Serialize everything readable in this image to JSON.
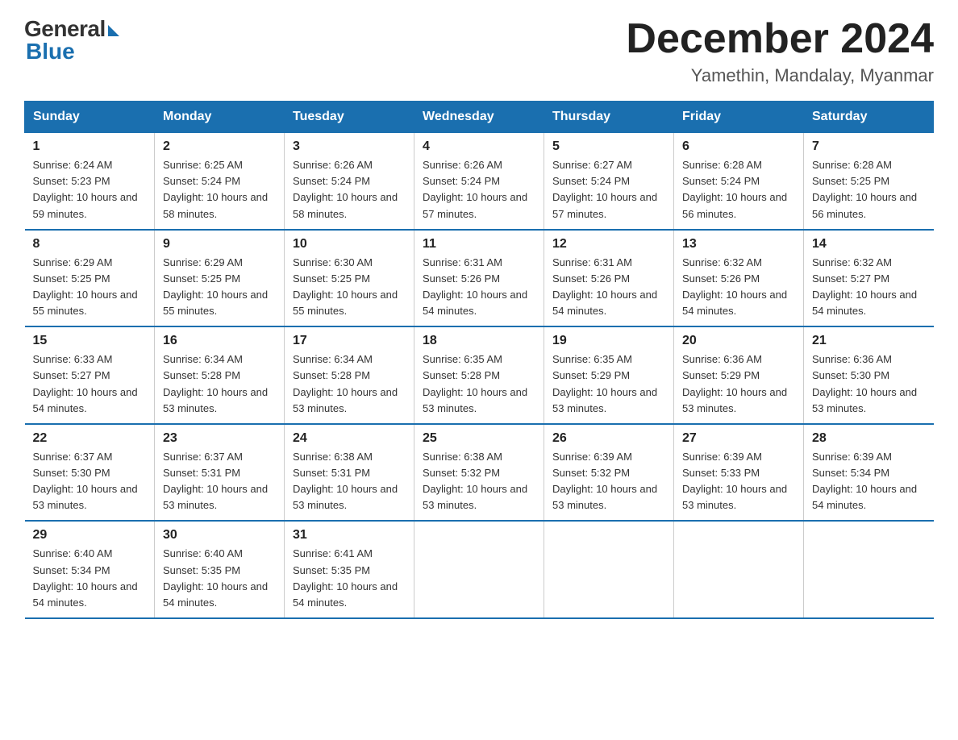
{
  "header": {
    "logo": {
      "general": "General",
      "blue": "Blue"
    },
    "title": "December 2024",
    "location": "Yamethin, Mandalay, Myanmar"
  },
  "calendar": {
    "columns": [
      "Sunday",
      "Monday",
      "Tuesday",
      "Wednesday",
      "Thursday",
      "Friday",
      "Saturday"
    ],
    "rows": [
      [
        {
          "date": "1",
          "sunrise": "Sunrise: 6:24 AM",
          "sunset": "Sunset: 5:23 PM",
          "daylight": "Daylight: 10 hours and 59 minutes."
        },
        {
          "date": "2",
          "sunrise": "Sunrise: 6:25 AM",
          "sunset": "Sunset: 5:24 PM",
          "daylight": "Daylight: 10 hours and 58 minutes."
        },
        {
          "date": "3",
          "sunrise": "Sunrise: 6:26 AM",
          "sunset": "Sunset: 5:24 PM",
          "daylight": "Daylight: 10 hours and 58 minutes."
        },
        {
          "date": "4",
          "sunrise": "Sunrise: 6:26 AM",
          "sunset": "Sunset: 5:24 PM",
          "daylight": "Daylight: 10 hours and 57 minutes."
        },
        {
          "date": "5",
          "sunrise": "Sunrise: 6:27 AM",
          "sunset": "Sunset: 5:24 PM",
          "daylight": "Daylight: 10 hours and 57 minutes."
        },
        {
          "date": "6",
          "sunrise": "Sunrise: 6:28 AM",
          "sunset": "Sunset: 5:24 PM",
          "daylight": "Daylight: 10 hours and 56 minutes."
        },
        {
          "date": "7",
          "sunrise": "Sunrise: 6:28 AM",
          "sunset": "Sunset: 5:25 PM",
          "daylight": "Daylight: 10 hours and 56 minutes."
        }
      ],
      [
        {
          "date": "8",
          "sunrise": "Sunrise: 6:29 AM",
          "sunset": "Sunset: 5:25 PM",
          "daylight": "Daylight: 10 hours and 55 minutes."
        },
        {
          "date": "9",
          "sunrise": "Sunrise: 6:29 AM",
          "sunset": "Sunset: 5:25 PM",
          "daylight": "Daylight: 10 hours and 55 minutes."
        },
        {
          "date": "10",
          "sunrise": "Sunrise: 6:30 AM",
          "sunset": "Sunset: 5:25 PM",
          "daylight": "Daylight: 10 hours and 55 minutes."
        },
        {
          "date": "11",
          "sunrise": "Sunrise: 6:31 AM",
          "sunset": "Sunset: 5:26 PM",
          "daylight": "Daylight: 10 hours and 54 minutes."
        },
        {
          "date": "12",
          "sunrise": "Sunrise: 6:31 AM",
          "sunset": "Sunset: 5:26 PM",
          "daylight": "Daylight: 10 hours and 54 minutes."
        },
        {
          "date": "13",
          "sunrise": "Sunrise: 6:32 AM",
          "sunset": "Sunset: 5:26 PM",
          "daylight": "Daylight: 10 hours and 54 minutes."
        },
        {
          "date": "14",
          "sunrise": "Sunrise: 6:32 AM",
          "sunset": "Sunset: 5:27 PM",
          "daylight": "Daylight: 10 hours and 54 minutes."
        }
      ],
      [
        {
          "date": "15",
          "sunrise": "Sunrise: 6:33 AM",
          "sunset": "Sunset: 5:27 PM",
          "daylight": "Daylight: 10 hours and 54 minutes."
        },
        {
          "date": "16",
          "sunrise": "Sunrise: 6:34 AM",
          "sunset": "Sunset: 5:28 PM",
          "daylight": "Daylight: 10 hours and 53 minutes."
        },
        {
          "date": "17",
          "sunrise": "Sunrise: 6:34 AM",
          "sunset": "Sunset: 5:28 PM",
          "daylight": "Daylight: 10 hours and 53 minutes."
        },
        {
          "date": "18",
          "sunrise": "Sunrise: 6:35 AM",
          "sunset": "Sunset: 5:28 PM",
          "daylight": "Daylight: 10 hours and 53 minutes."
        },
        {
          "date": "19",
          "sunrise": "Sunrise: 6:35 AM",
          "sunset": "Sunset: 5:29 PM",
          "daylight": "Daylight: 10 hours and 53 minutes."
        },
        {
          "date": "20",
          "sunrise": "Sunrise: 6:36 AM",
          "sunset": "Sunset: 5:29 PM",
          "daylight": "Daylight: 10 hours and 53 minutes."
        },
        {
          "date": "21",
          "sunrise": "Sunrise: 6:36 AM",
          "sunset": "Sunset: 5:30 PM",
          "daylight": "Daylight: 10 hours and 53 minutes."
        }
      ],
      [
        {
          "date": "22",
          "sunrise": "Sunrise: 6:37 AM",
          "sunset": "Sunset: 5:30 PM",
          "daylight": "Daylight: 10 hours and 53 minutes."
        },
        {
          "date": "23",
          "sunrise": "Sunrise: 6:37 AM",
          "sunset": "Sunset: 5:31 PM",
          "daylight": "Daylight: 10 hours and 53 minutes."
        },
        {
          "date": "24",
          "sunrise": "Sunrise: 6:38 AM",
          "sunset": "Sunset: 5:31 PM",
          "daylight": "Daylight: 10 hours and 53 minutes."
        },
        {
          "date": "25",
          "sunrise": "Sunrise: 6:38 AM",
          "sunset": "Sunset: 5:32 PM",
          "daylight": "Daylight: 10 hours and 53 minutes."
        },
        {
          "date": "26",
          "sunrise": "Sunrise: 6:39 AM",
          "sunset": "Sunset: 5:32 PM",
          "daylight": "Daylight: 10 hours and 53 minutes."
        },
        {
          "date": "27",
          "sunrise": "Sunrise: 6:39 AM",
          "sunset": "Sunset: 5:33 PM",
          "daylight": "Daylight: 10 hours and 53 minutes."
        },
        {
          "date": "28",
          "sunrise": "Sunrise: 6:39 AM",
          "sunset": "Sunset: 5:34 PM",
          "daylight": "Daylight: 10 hours and 54 minutes."
        }
      ],
      [
        {
          "date": "29",
          "sunrise": "Sunrise: 6:40 AM",
          "sunset": "Sunset: 5:34 PM",
          "daylight": "Daylight: 10 hours and 54 minutes."
        },
        {
          "date": "30",
          "sunrise": "Sunrise: 6:40 AM",
          "sunset": "Sunset: 5:35 PM",
          "daylight": "Daylight: 10 hours and 54 minutes."
        },
        {
          "date": "31",
          "sunrise": "Sunrise: 6:41 AM",
          "sunset": "Sunset: 5:35 PM",
          "daylight": "Daylight: 10 hours and 54 minutes."
        },
        null,
        null,
        null,
        null
      ]
    ]
  }
}
